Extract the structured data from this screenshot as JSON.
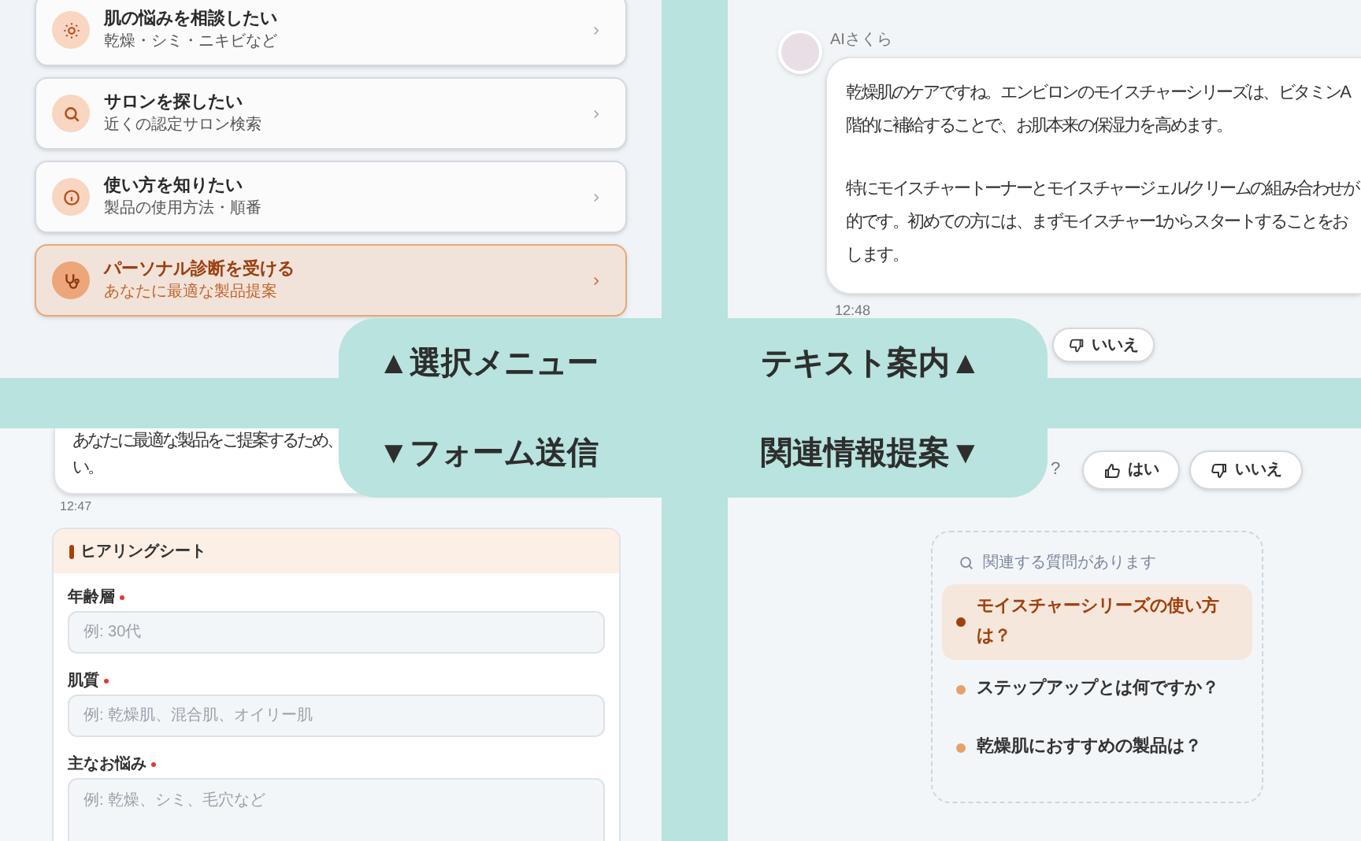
{
  "overlay_labels": [
    "▲選択メニュー",
    "テキスト案内▲",
    "▼フォーム送信",
    "関連情報提案▼"
  ],
  "menu": {
    "items": [
      {
        "title": "肌の悩みを相談したい",
        "subtitle": "乾燥・シミ・ニキビなど",
        "selected": false
      },
      {
        "title": "サロンを探したい",
        "subtitle": "近くの認定サロン検索",
        "selected": false
      },
      {
        "title": "使い方を知りたい",
        "subtitle": "製品の使用方法・順番",
        "selected": false
      },
      {
        "title": "パーソナル診断を受ける",
        "subtitle": "あなたに最適な製品提案",
        "selected": true
      }
    ]
  },
  "chat": {
    "sender": "AIさくら",
    "paragraphs": [
      [
        "乾燥肌のケアですね。エンビロンのモイスチャーシリーズは、ビタミンA",
        "階的に補給することで、お肌本来の保湿力を高めます。"
      ],
      [
        "特にモイスチャートーナーとモイスチャージェル/クリームの組み合わせが",
        "的です。初めての方には、まずモイスチャー1からスタートすることをお",
        "します。"
      ]
    ],
    "time": "12:48",
    "feedback": [
      "いいえ"
    ]
  },
  "form_section": {
    "message_lines": [
      "あなたに最適な製品をご提案するため、",
      "い。"
    ],
    "time": "12:47",
    "form": {
      "title": "ヒアリングシート",
      "fields": [
        {
          "label": "年齢層",
          "required": true,
          "placeholder": "例: 30代",
          "kind": "input"
        },
        {
          "label": "肌質",
          "required": true,
          "placeholder": "例: 乾燥肌、混合肌、オイリー肌",
          "kind": "input"
        },
        {
          "label": "主なお悩み",
          "required": true,
          "placeholder": "例: 乾燥、シミ、毛穴など",
          "kind": "textarea"
        }
      ]
    }
  },
  "suggestions": {
    "question_tail": "?",
    "feedback": [
      "はい",
      "いいえ"
    ],
    "related": {
      "heading": "関連する質問があります",
      "items": [
        {
          "text": "モイスチャーシリーズの使い方は？",
          "selected": true
        },
        {
          "text": "ステップアップとは何ですか？",
          "selected": false
        },
        {
          "text": "乾燥肌におすすめの製品は？",
          "selected": false
        }
      ]
    }
  }
}
